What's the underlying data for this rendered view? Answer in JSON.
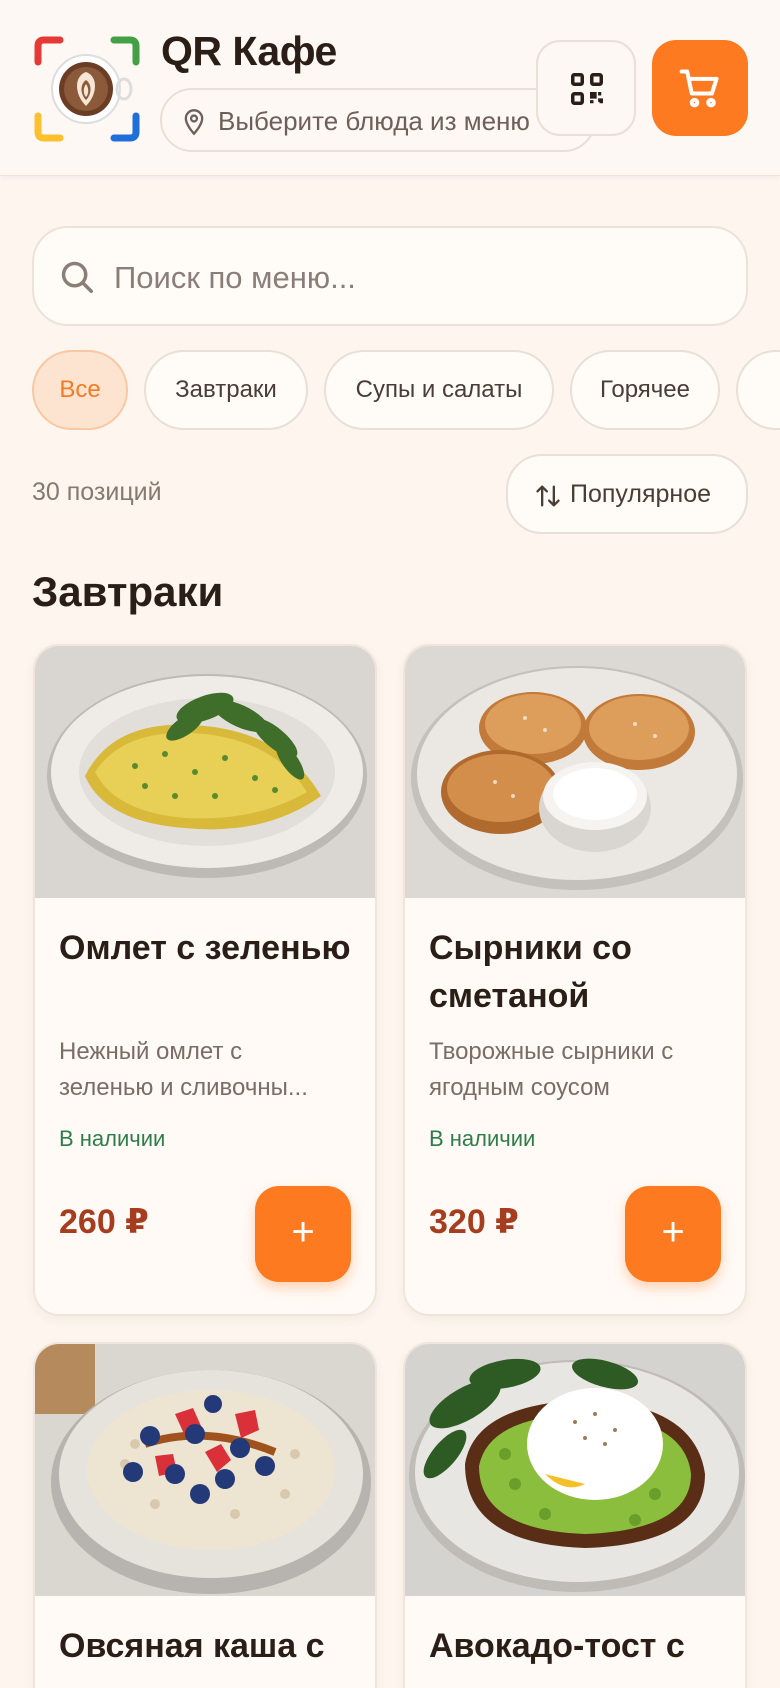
{
  "header": {
    "app_title": "QR Кафе",
    "location_text": "Выберите блюда из меню",
    "colors": {
      "accent": "#fd7a21"
    }
  },
  "search": {
    "placeholder": "Поиск по меню..."
  },
  "categories": [
    {
      "label": "Все",
      "active": true
    },
    {
      "label": "Завтраки",
      "active": false
    },
    {
      "label": "Супы и салаты",
      "active": false
    },
    {
      "label": "Горячее",
      "active": false
    },
    {
      "label": "",
      "active": false
    }
  ],
  "toolbar": {
    "count_text": "30 позиций",
    "sort_label": "Популярное"
  },
  "section": {
    "title": "Завтраки"
  },
  "items": [
    {
      "name": "Омлет с зеленью",
      "desc_line1": "Нежный омлет с",
      "desc_line2": "зеленью и сливочны...",
      "availability": "В наличии",
      "price": "260 ₽",
      "photo": "omelette-photo"
    },
    {
      "name": "Сырники со сметаной",
      "desc_line1": "Творожные сырники с",
      "desc_line2": "ягодным соусом",
      "availability": "В наличии",
      "price": "320 ₽",
      "photo": "syrniki-photo"
    },
    {
      "name": "Овсяная каша с",
      "photo": "oatmeal-photo"
    },
    {
      "name": "Авокадо-тост с",
      "photo": "avocado-toast-photo"
    }
  ],
  "add_button_label": "+"
}
